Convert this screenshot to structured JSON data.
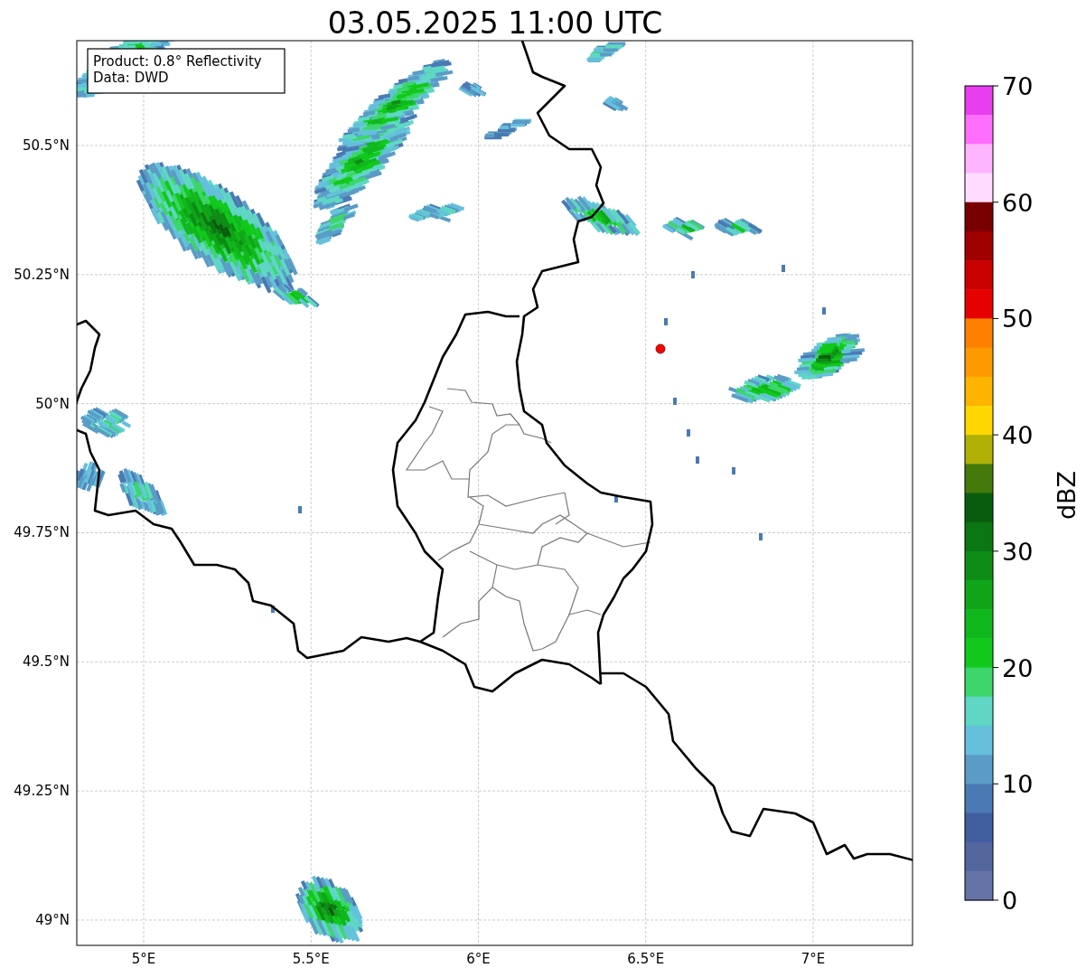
{
  "title": "03.05.2025 11:00 UTC",
  "info_box": {
    "lines": [
      "Product: 0.8° Reflectivity",
      "Data: DWD"
    ]
  },
  "map": {
    "yticks": [
      "50.5°N",
      "50.25°N",
      "50°N",
      "49.75°N",
      "49.5°N",
      "49.25°N",
      "49°N"
    ],
    "xticks": [
      "5°E",
      "5.5°E",
      "6°E",
      "6.5°E",
      "7°E"
    ]
  },
  "colorbar": {
    "label": "dBZ",
    "ticks": [
      "70",
      "60",
      "50",
      "40",
      "30",
      "20",
      "10",
      "0"
    ],
    "bins": [
      {
        "color": "#e83ef0"
      },
      {
        "color": "#ff6eff"
      },
      {
        "color": "#ffb4ff"
      },
      {
        "color": "#ffdcff"
      },
      {
        "color": "#780000"
      },
      {
        "color": "#a00000"
      },
      {
        "color": "#c80000"
      },
      {
        "color": "#e60000"
      },
      {
        "color": "#ff7f00"
      },
      {
        "color": "#ff9900"
      },
      {
        "color": "#ffb400"
      },
      {
        "color": "#ffd700"
      },
      {
        "color": "#b0b007"
      },
      {
        "color": "#447a0c"
      },
      {
        "color": "#095c0e"
      },
      {
        "color": "#0b7612"
      },
      {
        "color": "#0d8d16"
      },
      {
        "color": "#0fa517"
      },
      {
        "color": "#10b71d"
      },
      {
        "color": "#11c91b"
      },
      {
        "color": "#3cd66a"
      },
      {
        "color": "#5fd7c4"
      },
      {
        "color": "#64c0dc"
      },
      {
        "color": "#5a9cc6"
      },
      {
        "color": "#4a7ab3"
      },
      {
        "color": "#415ea1"
      },
      {
        "color": "#53669e"
      },
      {
        "color": "#6673a6"
      }
    ]
  }
}
